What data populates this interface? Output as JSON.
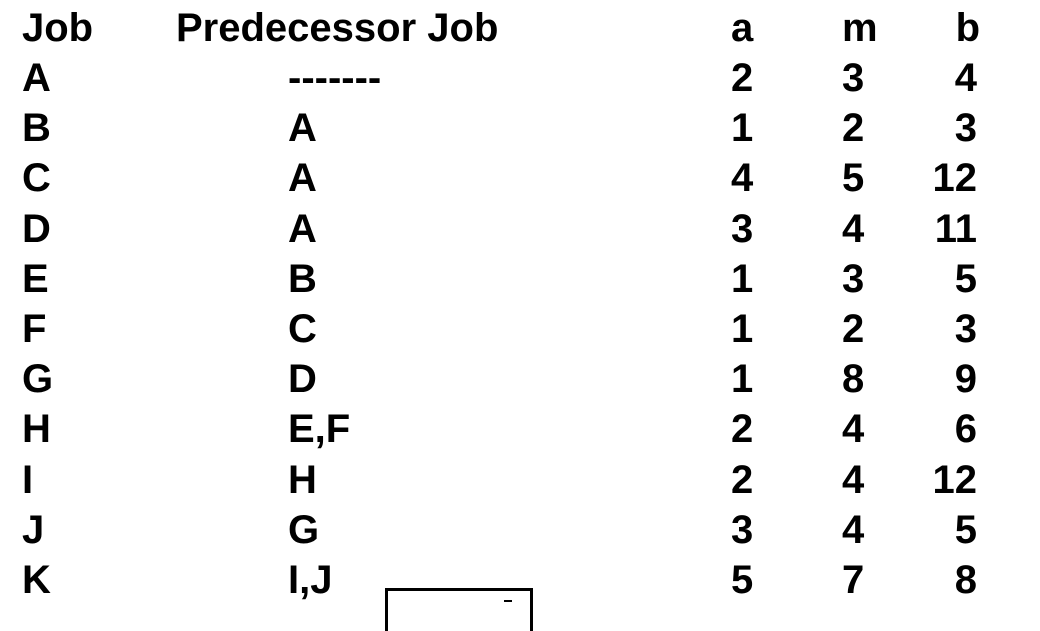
{
  "table": {
    "headers": {
      "job": "Job",
      "predecessor": "Predecessor Job",
      "a": "a",
      "m": "m",
      "b": "b"
    },
    "rows": [
      {
        "job": "A",
        "predecessor": "-------",
        "a": "2",
        "m": "3",
        "b": "4"
      },
      {
        "job": "B",
        "predecessor": "A",
        "a": "1",
        "m": "2",
        "b": "3"
      },
      {
        "job": "C",
        "predecessor": "A",
        "a": "4",
        "m": "5",
        "b": "12"
      },
      {
        "job": "D",
        "predecessor": "A",
        "a": "3",
        "m": "4",
        "b": "11"
      },
      {
        "job": "E",
        "predecessor": "B",
        "a": "1",
        "m": "3",
        "b": "5"
      },
      {
        "job": "F",
        "predecessor": "C",
        "a": "1",
        "m": "2",
        "b": "3"
      },
      {
        "job": "G",
        "predecessor": "D",
        "a": "1",
        "m": "8",
        "b": "9"
      },
      {
        "job": "H",
        "predecessor": "E,F",
        "a": "2",
        "m": "4",
        "b": "6"
      },
      {
        "job": "I",
        "predecessor": "H",
        "a": "2",
        "m": "4",
        "b": "12"
      },
      {
        "job": "J",
        "predecessor": "G",
        "a": "3",
        "m": "4",
        "b": "5"
      },
      {
        "job": "K",
        "predecessor": "I,J",
        "a": "5",
        "m": "7",
        "b": "8"
      }
    ]
  }
}
